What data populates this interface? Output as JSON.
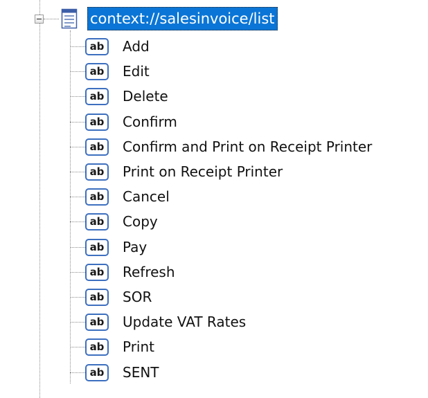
{
  "tree": {
    "root": {
      "label": "context://salesinvoice/list",
      "icon": "form-icon",
      "expanded": true
    },
    "icons": {
      "child_icon_text": "ab"
    },
    "children": [
      {
        "label": "Add"
      },
      {
        "label": "Edit"
      },
      {
        "label": "Delete"
      },
      {
        "label": "Confirm"
      },
      {
        "label": "Confirm and Print on Receipt Printer"
      },
      {
        "label": "Print on Receipt Printer"
      },
      {
        "label": "Cancel"
      },
      {
        "label": "Copy"
      },
      {
        "label": "Pay"
      },
      {
        "label": "Refresh"
      },
      {
        "label": "SOR"
      },
      {
        "label": "Update VAT Rates"
      },
      {
        "label": "Print"
      },
      {
        "label": "SENT"
      }
    ],
    "colors": {
      "selection": "#0a75d6",
      "icon_border": "#3d6fbf",
      "guide_line": "#8a8a8a"
    }
  }
}
